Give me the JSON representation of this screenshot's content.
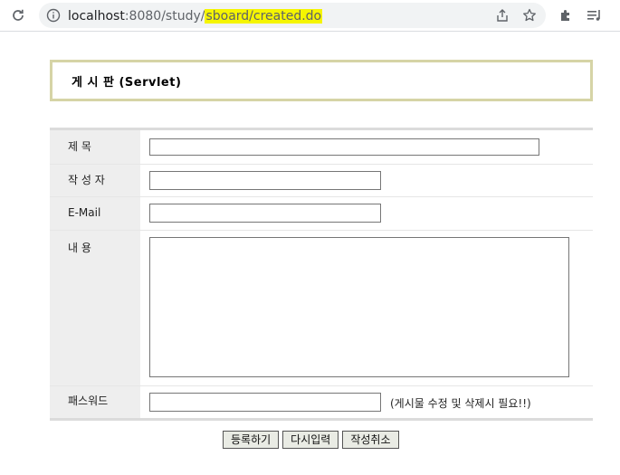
{
  "browser": {
    "url_host": "localhost",
    "url_port_path": ":8080/study/",
    "url_highlight": "sboard/created.do",
    "icons": [
      "reload-icon",
      "info-icon",
      "share-icon",
      "bookmark-star-icon",
      "extensions-icon",
      "reading-list-icon"
    ],
    "highlight_color": "#f5f500"
  },
  "page": {
    "title": "게 시 판 (Servlet)",
    "title_border_color": "#d6d4a6",
    "label_bg_color": "#eeeeee"
  },
  "form": {
    "subject_label": "제      목",
    "subject_value": "",
    "writer_label": "작 성 자",
    "writer_value": "",
    "email_label": "E-Mail",
    "email_value": "",
    "content_label": "내      용",
    "content_value": "",
    "password_label": "패스워드",
    "password_value": "",
    "password_hint": "(게시물 수정 및 삭제시 필요!!)"
  },
  "buttons": {
    "register": "등록하기",
    "reset": "다시입력",
    "cancel": "작성취소"
  }
}
